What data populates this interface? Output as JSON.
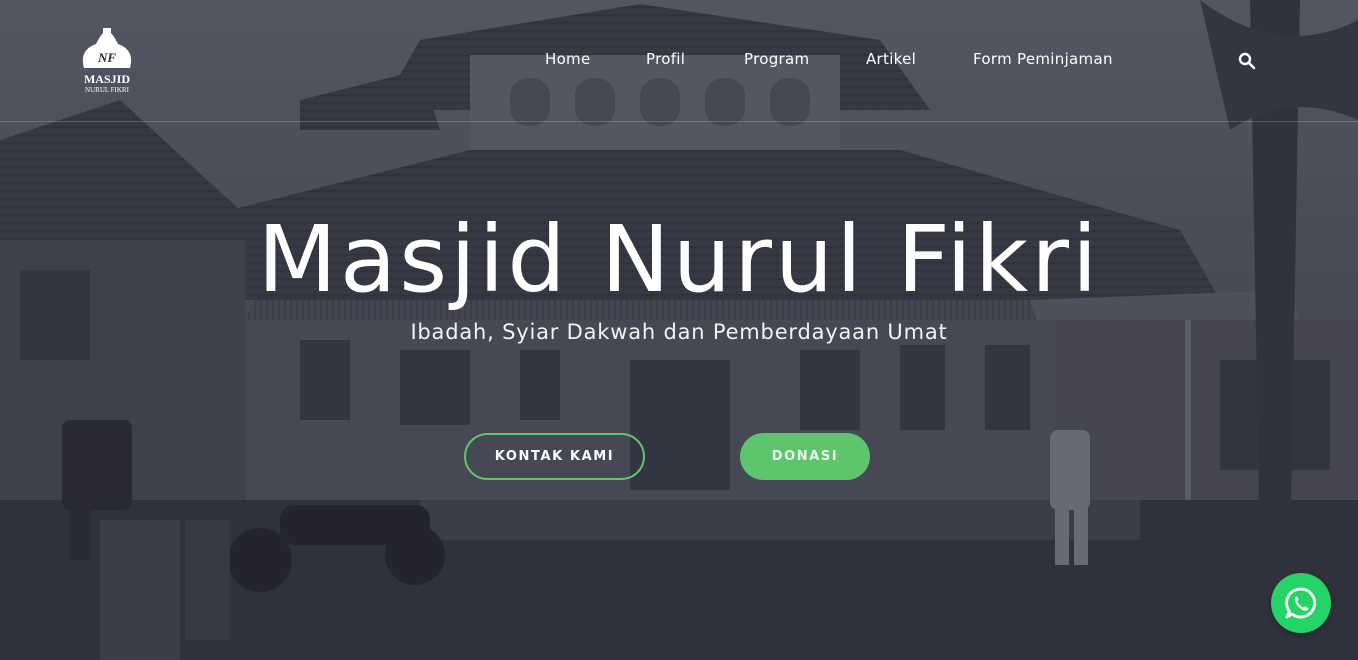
{
  "logo": {
    "text_line1": "MASJID",
    "text_line2": "NURUL FIKRI",
    "monogram": "NF"
  },
  "nav": {
    "items": [
      {
        "label": "Home"
      },
      {
        "label": "Profil"
      },
      {
        "label": "Program"
      },
      {
        "label": "Artikel"
      },
      {
        "label": "Form Peminjaman"
      }
    ],
    "search_icon": "search-icon"
  },
  "hero": {
    "title": "Masjid Nurul Fikri",
    "subtitle": "Ibadah, Syiar Dakwah dan Pemberdayaan Umat",
    "buttons": {
      "kontak_label": "KONTAK KAMI",
      "donasi_label": "DONASI"
    }
  },
  "floating": {
    "whatsapp_icon": "whatsapp-icon"
  },
  "colors": {
    "accent": "#5fc56d",
    "whatsapp": "#25d366",
    "overlay": "#262837"
  }
}
